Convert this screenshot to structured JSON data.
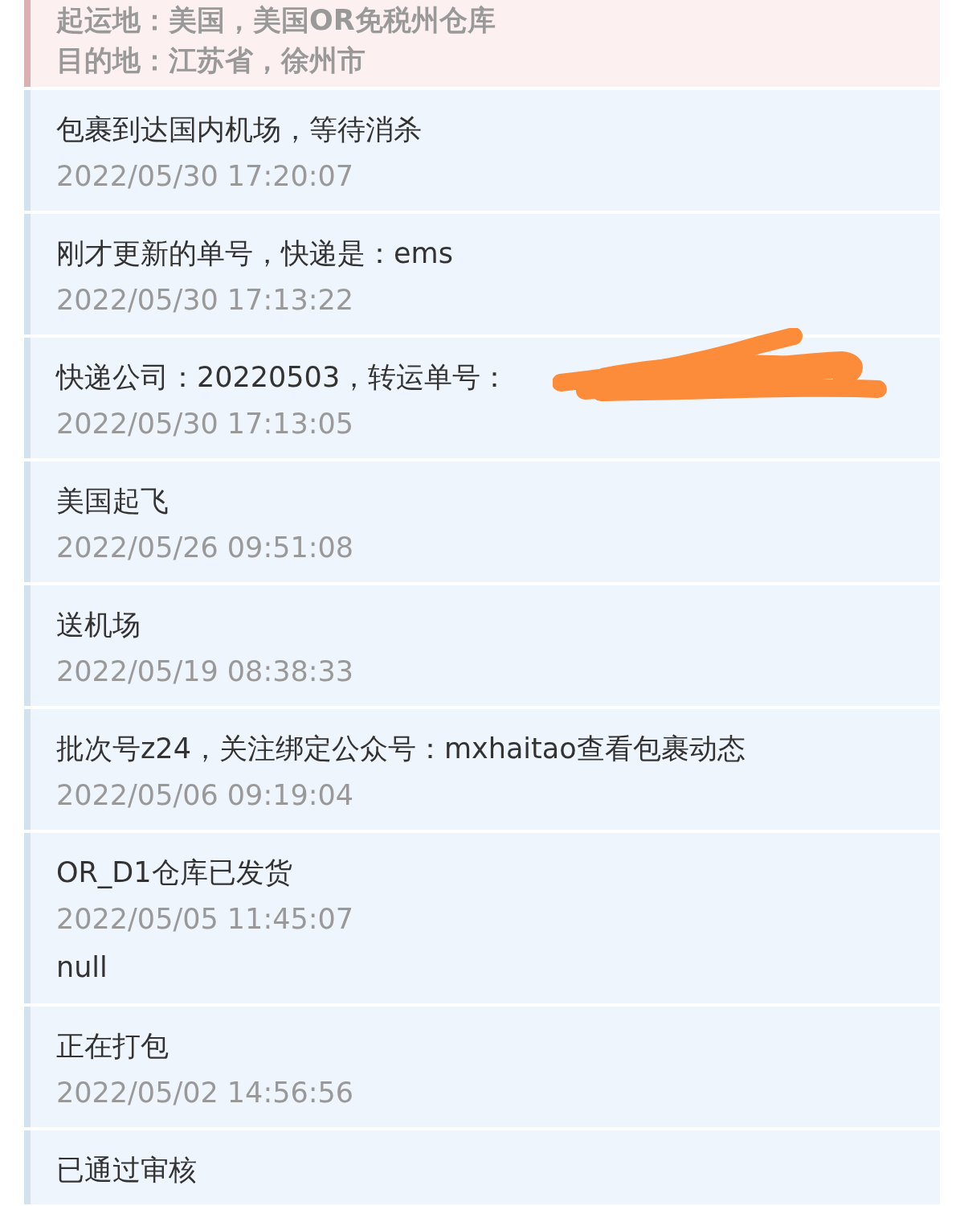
{
  "entries": [
    {
      "kind": "origin",
      "lines": [
        "起运地：美国，美国OR免税州仓库",
        "目的地：江苏省，徐州市"
      ]
    },
    {
      "kind": "event",
      "text": "包裹到达国内机场，等待消杀",
      "time": "2022/05/30 17:20:07"
    },
    {
      "kind": "event",
      "text": "刚才更新的单号，快递是：ems",
      "time": "2022/05/30 17:13:22"
    },
    {
      "kind": "event",
      "text": "快递公司：20220503，转运单号：",
      "time": "2022/05/30 17:13:05",
      "redacted": true
    },
    {
      "kind": "event",
      "text": "美国起飞",
      "time": "2022/05/26 09:51:08"
    },
    {
      "kind": "event",
      "text": "送机场",
      "time": "2022/05/19 08:38:33"
    },
    {
      "kind": "event",
      "text": "批次号z24，关注绑定公众号：mxhaitao查看包裹动态",
      "time": "2022/05/06 09:19:04"
    },
    {
      "kind": "event",
      "text": "OR_D1仓库已发货",
      "time": "2022/05/05 11:45:07",
      "note": "null"
    },
    {
      "kind": "event",
      "text": "正在打包",
      "time": "2022/05/02 14:56:56"
    },
    {
      "kind": "event",
      "text": "已通过审核"
    }
  ]
}
